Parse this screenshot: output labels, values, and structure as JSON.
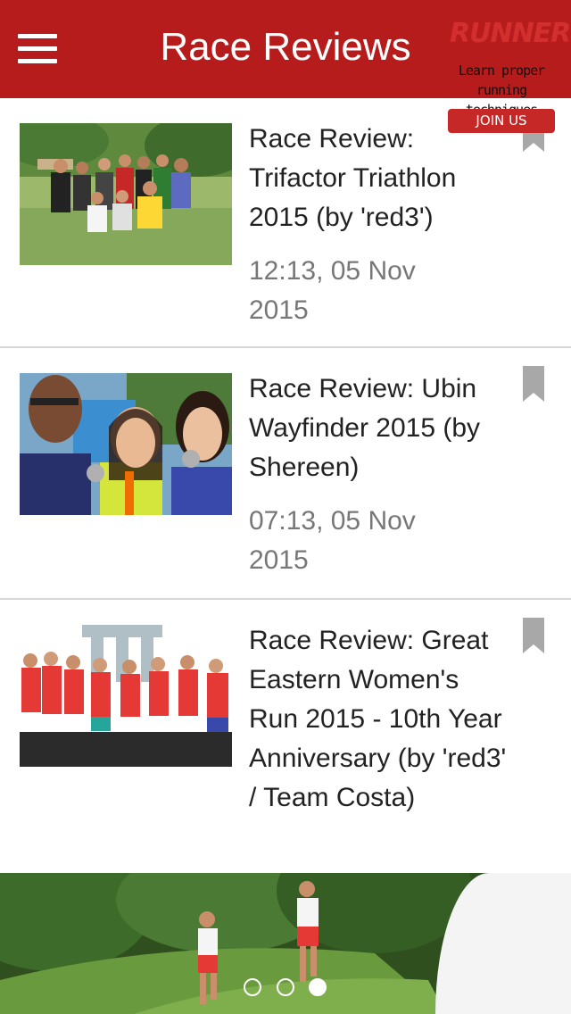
{
  "header": {
    "title": "Race Reviews",
    "menu_icon": "hamburger-menu-icon",
    "background": "#b71c1c"
  },
  "articles": [
    {
      "title": "Race Review: Trifactor Triathlon 2015 (by 'red3')",
      "date": "12:13, 05 Nov 2015",
      "thumbnail": "group photo of runners on grass",
      "bookmark_icon": "bookmark-icon"
    },
    {
      "title": "Race Review: Ubin Wayfinder 2015 (by Shereen)",
      "date": "07:13, 05 Nov 2015",
      "thumbnail": "selfie of three runners with medals",
      "bookmark_icon": "bookmark-icon"
    },
    {
      "title": "Race Review: Great Eastern Women's Run 2015 - 10th Year Anniversary (by 'red3' / Team Costa)",
      "date": "",
      "thumbnail": "women runners in red shirts with medals",
      "bookmark_icon": "bookmark-icon"
    }
  ],
  "banner": {
    "logo": "RUNNERS",
    "tagline": "Learn proper running techniques",
    "cta": "JOIN US",
    "page_count": 3,
    "active_page": 3
  }
}
